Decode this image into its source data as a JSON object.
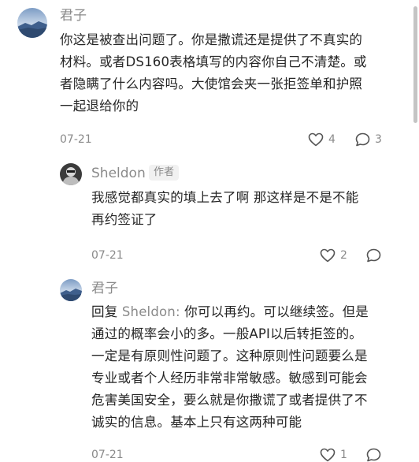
{
  "comments": [
    {
      "author": "君子",
      "lines": [
        "你这是被查出问题了。你是撒谎还是提供了不真实的",
        "材料。或者DS160表格填写的内容你自己不清楚。或",
        "者隐瞒了什么内容吗。大使馆会夹一张拒签单和护照",
        "一起退给你的"
      ],
      "date": "07-21",
      "likes": "4",
      "replies": "3"
    },
    {
      "author": "Sheldon",
      "badge": "作者",
      "lines": [
        "我感觉都真实的填上去了啊 那这样是不是不能",
        "再约签证了"
      ],
      "date": "07-21",
      "likes": "2"
    },
    {
      "author": "君子",
      "reply_prefix": "回复",
      "reply_to": "Sheldon:",
      "first_line_rest": " 你可以再约。可以继续签。但是",
      "lines": [
        "通过的概率会小的多。一般API以后转拒签的。",
        "一定是有原则性问题了。这种原则性问题要么是",
        "专业或者个人经历非常非常敏感。敏感到可能会",
        "危害美国安全，要么就是你撒谎了或者提供了不",
        "诚实的信息。基本上只有这两种可能"
      ],
      "date": "07-21",
      "likes": "1"
    }
  ],
  "icons": {
    "like": "heart-icon",
    "comment": "comment-bubble-icon"
  },
  "colors": {
    "text": "#262626",
    "meta": "#8a8a8a",
    "badge_bg": "#f1f1f1"
  }
}
